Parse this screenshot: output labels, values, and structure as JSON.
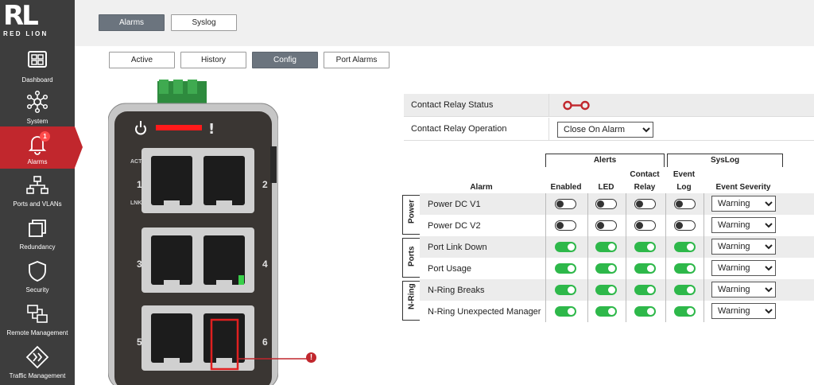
{
  "logo": {
    "letters": "RL",
    "subtext": "RED LION"
  },
  "sidebar": {
    "items": [
      {
        "label": "Dashboard",
        "icon": "dashboard-icon"
      },
      {
        "label": "System",
        "icon": "system-network-icon"
      },
      {
        "label": "Alarms",
        "icon": "bell-icon",
        "badge": "1",
        "active": true
      },
      {
        "label": "Ports and VLANs",
        "icon": "network-ports-icon"
      },
      {
        "label": "Redundancy",
        "icon": "redundancy-icon"
      },
      {
        "label": "Security",
        "icon": "shield-icon"
      },
      {
        "label": "Remote Management",
        "icon": "remote-management-icon"
      },
      {
        "label": "Traffic Management",
        "icon": "traffic-icon"
      }
    ]
  },
  "top_tabs": [
    {
      "label": "Alarms",
      "active": true
    },
    {
      "label": "Syslog",
      "active": false
    }
  ],
  "sub_tabs": [
    {
      "label": "Active",
      "active": false
    },
    {
      "label": "History",
      "active": false
    },
    {
      "label": "Config",
      "active": true
    },
    {
      "label": "Port Alarms",
      "active": false
    }
  ],
  "device": {
    "port_numbers": [
      "1",
      "2",
      "3",
      "4",
      "5",
      "6"
    ],
    "act_label": "ACT",
    "lnk_label": "LNK",
    "alert_port": "6",
    "alert_marker": "!"
  },
  "relay": {
    "status_label": "Contact Relay Status",
    "operation_label": "Contact Relay Operation",
    "operation_value": "Close On Alarm",
    "operation_options": [
      "Close On Alarm"
    ]
  },
  "alarm_table": {
    "group_alerts": "Alerts",
    "group_syslog": "SysLog",
    "col_alarm": "Alarm",
    "col_enabled": "Enabled",
    "col_led": "LED",
    "col_contact_1": "Contact",
    "col_contact_2": "Relay",
    "col_event_1": "Event",
    "col_event_2": "Log",
    "col_severity": "Event Severity",
    "categories": [
      {
        "label": "Power",
        "rows": 2
      },
      {
        "label": "Ports",
        "rows": 2
      },
      {
        "label": "N-Ring",
        "rows": 2
      }
    ],
    "rows": [
      {
        "name": "Power DC V1",
        "enabled": false,
        "led": false,
        "relay": false,
        "event_log": false,
        "severity": "Warning"
      },
      {
        "name": "Power DC V2",
        "enabled": false,
        "led": false,
        "relay": false,
        "event_log": false,
        "severity": "Warning"
      },
      {
        "name": "Port Link Down",
        "enabled": true,
        "led": true,
        "relay": true,
        "event_log": true,
        "severity": "Warning"
      },
      {
        "name": "Port Usage",
        "enabled": true,
        "led": true,
        "relay": true,
        "event_log": true,
        "severity": "Warning"
      },
      {
        "name": "N-Ring Breaks",
        "enabled": true,
        "led": true,
        "relay": true,
        "event_log": true,
        "severity": "Warning"
      },
      {
        "name": "N-Ring Unexpected Manager",
        "enabled": true,
        "led": true,
        "relay": true,
        "event_log": true,
        "severity": "Warning"
      }
    ]
  },
  "colors": {
    "brand_red": "#c1272d",
    "toggle_on": "#2eb84a",
    "active_tab": "#6b747e",
    "sidebar_bg": "#3d3d3d"
  }
}
